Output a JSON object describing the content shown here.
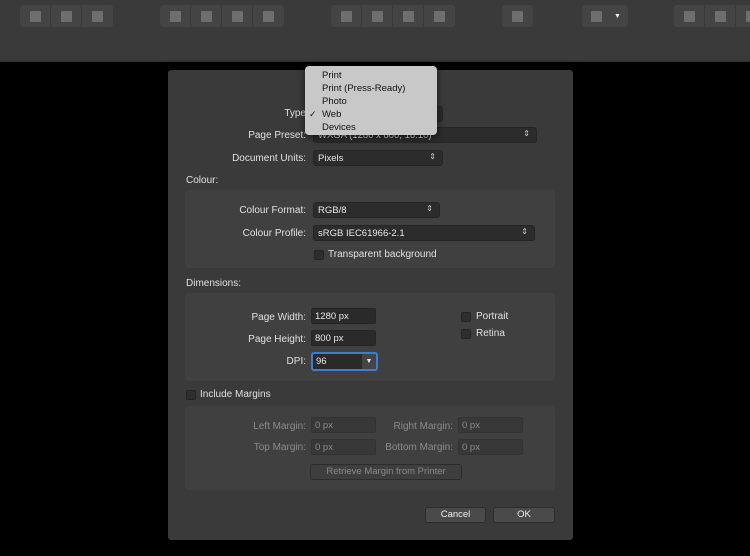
{
  "toolbar": {
    "groups": [
      {
        "icons": [
          "select-all-icon",
          "select-none-icon",
          "invert-selection-icon"
        ]
      },
      {
        "icons": [
          "move-to-back-icon",
          "move-back-one-icon",
          "move-forward-one-icon",
          "move-to-front-icon"
        ]
      },
      {
        "icons": [
          "flip-horizontal-icon",
          "flip-vertical-icon",
          "rotate-left-icon",
          "rotate-right-icon"
        ]
      },
      {
        "icons": [
          "align-icon"
        ]
      },
      {
        "icons": [
          "snapping-magnet-icon",
          "dropdown-arrow-icon"
        ]
      },
      {
        "icons": [
          "add-shape-icon",
          "subtract-shape-icon",
          "intersect-shape-icon"
        ]
      }
    ]
  },
  "dialog": {
    "type_label": "Type",
    "type_menu": {
      "options": [
        "Print",
        "Print (Press-Ready)",
        "Photo",
        "Web",
        "Devices"
      ],
      "selected": "Web"
    },
    "page_preset_label": "Page Preset:",
    "page_preset_value": "WXGA (1280 x 800, 16:10)",
    "document_units_label": "Document Units:",
    "document_units_value": "Pixels",
    "colour_heading": "Colour:",
    "colour_format_label": "Colour Format:",
    "colour_format_value": "RGB/8",
    "colour_profile_label": "Colour Profile:",
    "colour_profile_value": "sRGB IEC61966-2.1",
    "transparent_label": "Transparent background",
    "dimensions_heading": "Dimensions:",
    "page_width_label": "Page Width:",
    "page_width_value": "1280 px",
    "page_height_label": "Page Height:",
    "page_height_value": "800 px",
    "dpi_label": "DPI:",
    "dpi_value": "96",
    "portrait_label": "Portrait",
    "retina_label": "Retina",
    "include_margins_label": "Include Margins",
    "left_margin_label": "Left Margin:",
    "left_margin_value": "0 px",
    "right_margin_label": "Right Margin:",
    "right_margin_value": "0 px",
    "top_margin_label": "Top Margin:",
    "top_margin_value": "0 px",
    "bottom_margin_label": "Bottom Margin:",
    "bottom_margin_value": "0 px",
    "retrieve_button": "Retrieve Margin from Printer",
    "cancel_button": "Cancel",
    "ok_button": "OK",
    "focus_color": "#3b7fd0"
  }
}
